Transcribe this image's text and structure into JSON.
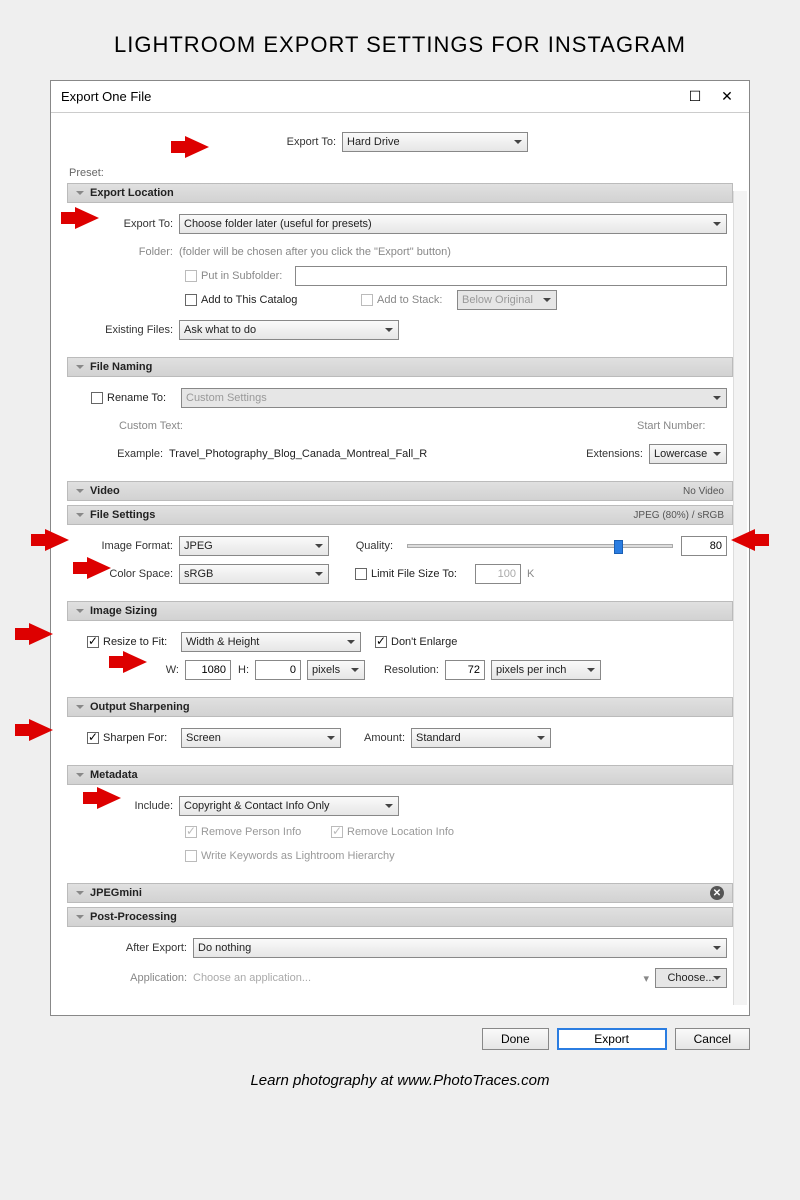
{
  "page": {
    "title": "LIGHTROOM EXPORT SETTINGS FOR INSTAGRAM",
    "caption": "Learn photography at www.PhotoTraces.com"
  },
  "dialog": {
    "title": "Export One File"
  },
  "top": {
    "export_to_label": "Export To:",
    "export_to_value": "Hard Drive",
    "preset_label": "Preset:"
  },
  "sections": {
    "export_location": {
      "header": "Export Location",
      "export_to_label": "Export To:",
      "export_to_value": "Choose folder later (useful for presets)",
      "folder_label": "Folder:",
      "folder_text": "(folder will be chosen after you click the \"Export\" button)",
      "put_in_subfolder": "Put in Subfolder:",
      "add_to_catalog": "Add to This Catalog",
      "add_to_stack": "Add to Stack:",
      "below_original": "Below Original",
      "existing_files_label": "Existing Files:",
      "existing_files_value": "Ask what to do"
    },
    "file_naming": {
      "header": "File Naming",
      "rename_to": "Rename To:",
      "rename_value": "Custom Settings",
      "custom_text_label": "Custom Text:",
      "start_number_label": "Start Number:",
      "example_label": "Example:",
      "example_value": "Travel_Photography_Blog_Canada_Montreal_Fall_R",
      "extensions_label": "Extensions:",
      "extensions_value": "Lowercase"
    },
    "video": {
      "header": "Video",
      "right": "No Video"
    },
    "file_settings": {
      "header": "File Settings",
      "right": "JPEG (80%) / sRGB",
      "image_format_label": "Image Format:",
      "image_format_value": "JPEG",
      "quality_label": "Quality:",
      "quality_value": "80",
      "color_space_label": "Color Space:",
      "color_space_value": "sRGB",
      "limit_file_size": "Limit File Size To:",
      "limit_value": "100",
      "limit_unit": "K"
    },
    "image_sizing": {
      "header": "Image Sizing",
      "resize_to_fit": "Resize to Fit:",
      "resize_value": "Width & Height",
      "dont_enlarge": "Don't Enlarge",
      "w_label": "W:",
      "w_value": "1080",
      "h_label": "H:",
      "h_value": "0",
      "unit_value": "pixels",
      "resolution_label": "Resolution:",
      "resolution_value": "72",
      "resolution_unit": "pixels per inch"
    },
    "output_sharpening": {
      "header": "Output Sharpening",
      "sharpen_for": "Sharpen For:",
      "sharpen_value": "Screen",
      "amount_label": "Amount:",
      "amount_value": "Standard"
    },
    "metadata": {
      "header": "Metadata",
      "include_label": "Include:",
      "include_value": "Copyright & Contact Info Only",
      "remove_person": "Remove Person Info",
      "remove_location": "Remove Location Info",
      "write_keywords": "Write Keywords as Lightroom Hierarchy"
    },
    "jpegmini": {
      "header": "JPEGmini"
    },
    "post_processing": {
      "header": "Post-Processing",
      "after_export_label": "After Export:",
      "after_export_value": "Do nothing",
      "application_label": "Application:",
      "application_placeholder": "Choose an application...",
      "choose_btn": "Choose..."
    }
  },
  "buttons": {
    "done": "Done",
    "export": "Export",
    "cancel": "Cancel"
  }
}
